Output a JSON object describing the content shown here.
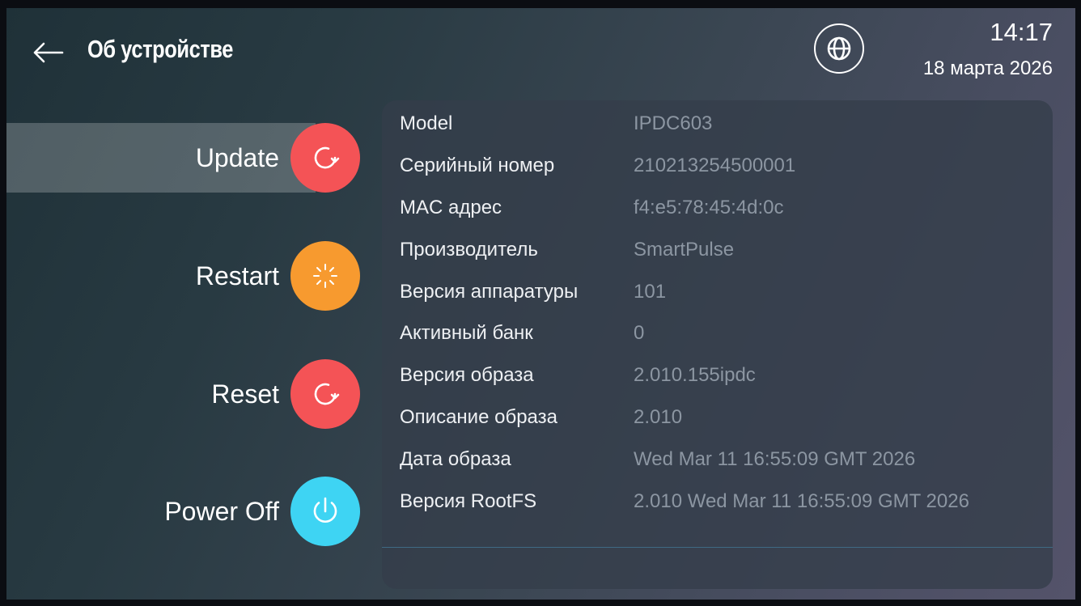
{
  "header": {
    "title": "Об устройстве",
    "time": "14:17",
    "date": "18 марта 2026"
  },
  "icons": {
    "back": "arrow-left-icon",
    "language": "globe-icon",
    "update": "refresh-icon",
    "restart": "burst-icon",
    "reset": "refresh-icon",
    "power_off": "power-icon"
  },
  "colors": {
    "update": "#f45356",
    "restart": "#f79a2f",
    "reset": "#f45356",
    "power_off": "#3ed4f3",
    "value_text": "#8c96a2"
  },
  "actions": [
    {
      "id": "update",
      "label": "Update",
      "selected": true
    },
    {
      "id": "restart",
      "label": "Restart",
      "selected": false
    },
    {
      "id": "reset",
      "label": "Reset",
      "selected": false
    },
    {
      "id": "power-off",
      "label": "Power Off",
      "selected": false
    }
  ],
  "info": [
    {
      "key": "Model",
      "value": "IPDC603"
    },
    {
      "key": "Серийный номер",
      "value": "210213254500001"
    },
    {
      "key": "MAC адрес",
      "value": "f4:e5:78:45:4d:0c"
    },
    {
      "key": "Производитель",
      "value": "SmartPulse"
    },
    {
      "key": "Версия аппаратуры",
      "value": "101"
    },
    {
      "key": "Активный банк",
      "value": "0"
    },
    {
      "key": "Версия образа",
      "value": "2.010.155ipdc"
    },
    {
      "key": "Описание образа",
      "value": "2.010"
    },
    {
      "key": "Дата образа",
      "value": "Wed Mar 11 16:55:09 GMT 2026"
    },
    {
      "key": "Версия RootFS",
      "value": "2.010 Wed Mar 11 16:55:09 GMT 2026"
    }
  ]
}
